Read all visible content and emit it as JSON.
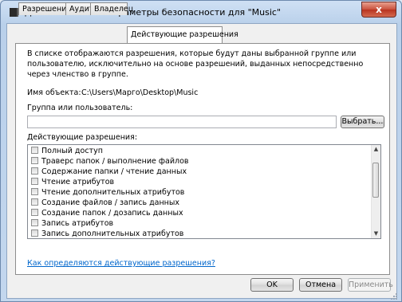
{
  "window": {
    "title": "Дополнительные параметры безопасности  для \"Music\"",
    "close_glyph": "x"
  },
  "tabs": [
    {
      "label": "Разрешения"
    },
    {
      "label": "Аудит"
    },
    {
      "label": "Владелец"
    },
    {
      "label": "Действующие разрешения",
      "active": true
    }
  ],
  "panel": {
    "description": "В списке отображаются разрешения, которые будут даны выбранной группе или пользователю, исключительно на основе разрешений, выданных непосредственно через членство в группе.",
    "object_name_label": "Имя объекта:",
    "object_name_value": "C:\\Users\\Марго\\Desktop\\Music",
    "group_label": "Группа или пользователь:",
    "group_value": "",
    "select_button": "Выбрать...",
    "permissions_label": "Действующие разрешения:",
    "permissions": [
      {
        "label": "Полный доступ",
        "checked": false
      },
      {
        "label": "Траверс папок / выполнение файлов",
        "checked": false
      },
      {
        "label": "Содержание папки / чтение данных",
        "checked": false
      },
      {
        "label": "Чтение атрибутов",
        "checked": false
      },
      {
        "label": "Чтение дополнительных атрибутов",
        "checked": false
      },
      {
        "label": "Создание файлов / запись данных",
        "checked": false
      },
      {
        "label": "Создание папок / дозапись данных",
        "checked": false
      },
      {
        "label": "Запись атрибутов",
        "checked": false
      },
      {
        "label": "Запись дополнительных атрибутов",
        "checked": false
      }
    ],
    "help_link": "Как определяются действующие разрешения?"
  },
  "buttons": {
    "ok": "OK",
    "cancel": "Отмена",
    "apply": "Применить"
  },
  "icons": {
    "window": "folder-window-icon",
    "close": "close-icon",
    "scroll_up": "arrow-up-icon",
    "scroll_down": "arrow-down-icon"
  }
}
